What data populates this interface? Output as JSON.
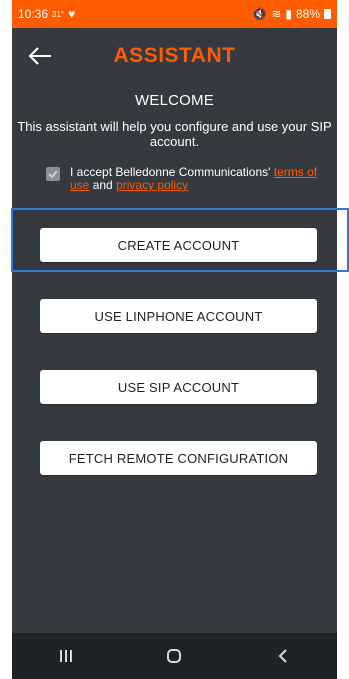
{
  "status": {
    "time": "10:36",
    "temp": "31°",
    "battery": "88%"
  },
  "header": {
    "title": "ASSISTANT"
  },
  "welcome": {
    "heading": "WELCOME",
    "description": "This assistant will help you configure and use your SIP account."
  },
  "terms": {
    "prefix": "I accept Belledonne Communications' ",
    "terms_link": "terms of use",
    "and_text": " and ",
    "privacy_link": "privacy policy",
    "checked": true
  },
  "buttons": {
    "create_account": "CREATE ACCOUNT",
    "use_linphone": "USE LINPHONE ACCOUNT",
    "use_sip": "USE SIP ACCOUNT",
    "fetch_remote": "FETCH REMOTE CONFIGURATION"
  },
  "colors": {
    "accent": "#ff5b00",
    "background": "#343a40",
    "highlight": "#2d7bd3"
  },
  "icons": {
    "back": "arrow-left-icon",
    "recents": "recents-icon",
    "home": "home-icon",
    "nav_back": "chevron-left-icon",
    "mute": "mute-icon",
    "wifi": "wifi-icon",
    "signal": "signal-icon",
    "battery": "battery-icon"
  }
}
